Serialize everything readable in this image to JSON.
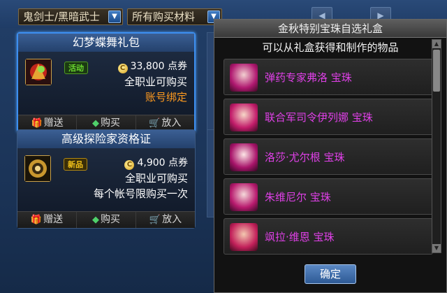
{
  "filters": {
    "character": "鬼剑士/黑暗武士",
    "material": "所有购买材料"
  },
  "cards": [
    {
      "title": "幻梦蝶舞礼包",
      "badge": "活动",
      "price": "33,800 点券",
      "line1": "全职业可购买",
      "line2": "账号绑定",
      "gift": "赠送",
      "buy": "购买",
      "cart": "放入"
    },
    {
      "title": "高级探险家资格证",
      "badge": "新品",
      "price": "4,900 点券",
      "line1": "全职业可购买",
      "line2": "每个帐号限购买一次",
      "gift": "赠送",
      "buy": "购买",
      "cart": "放入"
    }
  ],
  "dialog": {
    "title": "金秋特别宝珠自选礼盒",
    "subtitle": "可以从礼盒获得和制作的物品",
    "items": [
      {
        "name": "弹药专家弗洛 宝珠"
      },
      {
        "name": "联合军司令伊列娜 宝珠"
      },
      {
        "name": "洛莎·尤尔根 宝珠"
      },
      {
        "name": "朱维尼尔 宝珠"
      },
      {
        "name": "飒拉·维恩 宝珠"
      }
    ],
    "confirm": "确定"
  },
  "colors": {
    "item_name": "#e040e8",
    "badge_green": "#6ad92e",
    "badge_yellow": "#f2c21a",
    "orange_text": "#ff9a1f"
  }
}
